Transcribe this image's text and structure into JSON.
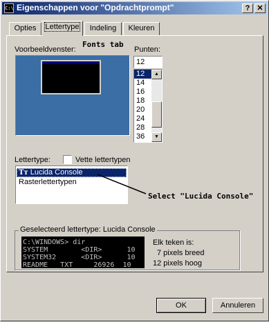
{
  "window": {
    "title": "Eigenschappen voor \"Opdrachtprompt\"",
    "icon_text": "C:\\",
    "help_btn": "?",
    "close_btn": "✕"
  },
  "tabs": [
    {
      "label": "Opties",
      "active": false
    },
    {
      "label": "Lettertype",
      "active": true
    },
    {
      "label": "Indeling",
      "active": false
    },
    {
      "label": "Kleuren",
      "active": false
    }
  ],
  "annotations": {
    "fonts_tab": "Fonts tab",
    "select_lucida": "Select \"Lucida Console\""
  },
  "preview": {
    "label": "Voorbeeldvenster:"
  },
  "points": {
    "label": "Punten:",
    "value": "12",
    "items": [
      "12",
      "14",
      "16",
      "18",
      "20",
      "24",
      "28",
      "36"
    ],
    "selected": "12"
  },
  "font": {
    "label": "Lettertype:",
    "bold_label": "Vette lettertypen",
    "bold_checked": false,
    "items": [
      {
        "icon": "truetype-icon",
        "label": "Lucida Console",
        "selected": true
      },
      {
        "icon": "",
        "label": "Rasterlettertypen",
        "selected": false
      }
    ]
  },
  "selected_font": {
    "legend": "Geselecteerd lettertype: Lucida Console",
    "console_lines": [
      "C:\\WINDOWS> dir",
      "SYSTEM        <DIR>      10",
      "SYSTEM32      <DIR>      10",
      "README   TXT     26926  10"
    ],
    "char_heading": "Elk teken is:",
    "char_width": "7 pixels breed",
    "char_height": "12 pixels hoog"
  },
  "buttons": {
    "ok": "OK",
    "cancel": "Annuleren"
  },
  "colors": {
    "titlebar_start": "#0a246a",
    "titlebar_end": "#a6caf0",
    "desktop": "#3a6ea5",
    "selection": "#0a246a"
  }
}
